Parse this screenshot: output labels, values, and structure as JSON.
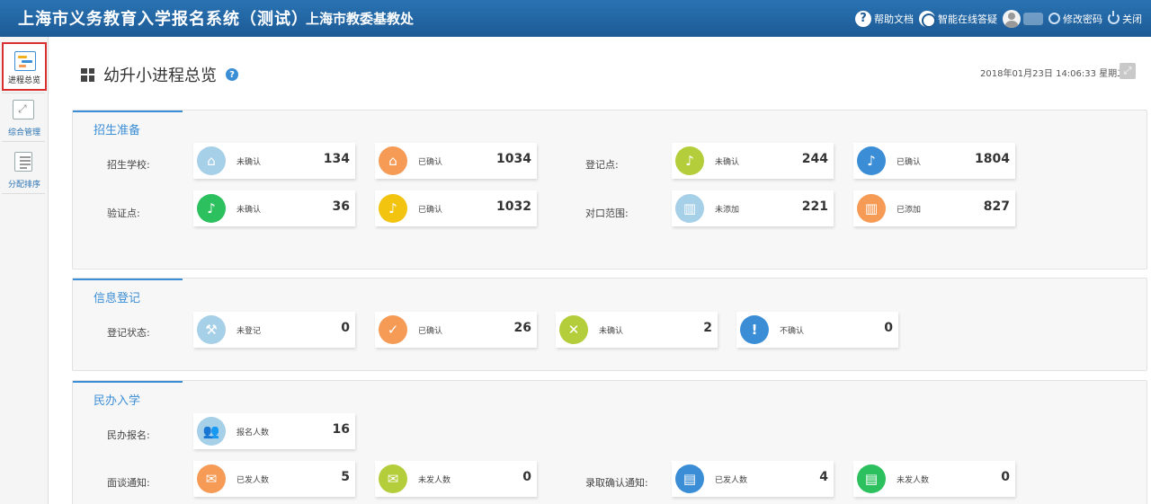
{
  "header": {
    "app_title": "上海市义务教育入学报名系统（测试）",
    "org_name": "上海市教委基教处",
    "help_docs": "帮助文档",
    "smart_qa": "智能在线答疑",
    "change_password": "修改密码",
    "close": "关闭"
  },
  "sidebar": {
    "items": [
      {
        "label": "进程总览",
        "icon": "gantt-icon"
      },
      {
        "label": "综合管理",
        "icon": "expand-icon"
      },
      {
        "label": "分配排序",
        "icon": "document-icon"
      }
    ]
  },
  "page": {
    "title": "幼升小进程总览",
    "datetime": "2018年01月23日 14:06:33 星期二"
  },
  "panels": {
    "recruit_prep": {
      "title": "招生准备",
      "labels": {
        "schools": "招生学校:",
        "registration_points": "登记点:",
        "verification_points": "验证点:",
        "catchment_area": "对口范围:"
      },
      "cards": [
        {
          "label": "未确认",
          "value": "134",
          "color": "#a6cfe8",
          "icon": "home-icon"
        },
        {
          "label": "已确认",
          "value": "1034",
          "color": "#f59b56",
          "icon": "home-icon"
        },
        {
          "label": "未确认",
          "value": "244",
          "color": "#b4cd3a",
          "icon": "bell-icon"
        },
        {
          "label": "已确认",
          "value": "1804",
          "color": "#3b8ed6",
          "icon": "bell-icon"
        },
        {
          "label": "未确认",
          "value": "36",
          "color": "#2dc05e",
          "icon": "bell-icon"
        },
        {
          "label": "已确认",
          "value": "1032",
          "color": "#f2c40f",
          "icon": "bell-icon"
        },
        {
          "label": "未添加",
          "value": "221",
          "color": "#a6cfe8",
          "icon": "bank-icon"
        },
        {
          "label": "已添加",
          "value": "827",
          "color": "#f59b56",
          "icon": "bank-icon"
        }
      ]
    },
    "info_registration": {
      "title": "信息登记",
      "labels": {
        "status": "登记状态:"
      },
      "cards": [
        {
          "label": "未登记",
          "value": "0",
          "color": "#a6cfe8",
          "icon": "gavel-icon"
        },
        {
          "label": "已确认",
          "value": "26",
          "color": "#f59b56",
          "icon": "check-icon"
        },
        {
          "label": "未确认",
          "value": "2",
          "color": "#b4cd3a",
          "icon": "x-icon"
        },
        {
          "label": "不确认",
          "value": "0",
          "color": "#3b8ed6",
          "icon": "exclamation-icon"
        }
      ]
    },
    "private_enrollment": {
      "title": "民办入学",
      "labels": {
        "private_signup": "民办报名:",
        "interview_notice": "面谈通知:",
        "admission_confirm": "录取确认通知:"
      },
      "cards": [
        {
          "label": "报名人数",
          "value": "16",
          "color": "#a6cfe8",
          "icon": "users-icon"
        },
        {
          "label": "已发人数",
          "value": "5",
          "color": "#f59b56",
          "icon": "envelope-icon"
        },
        {
          "label": "未发人数",
          "value": "0",
          "color": "#b4cd3a",
          "icon": "envelope-icon"
        },
        {
          "label": "已发人数",
          "value": "4",
          "color": "#3b8ed6",
          "icon": "file-icon"
        },
        {
          "label": "未发人数",
          "value": "0",
          "color": "#2dc05e",
          "icon": "file-icon"
        }
      ]
    }
  }
}
